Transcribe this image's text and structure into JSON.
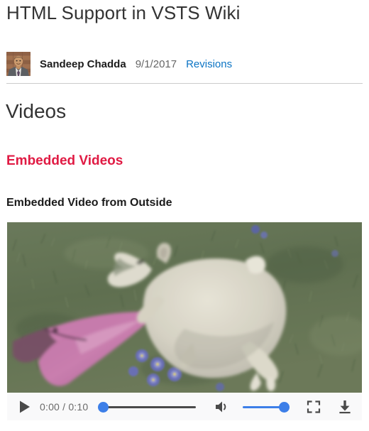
{
  "page": {
    "title": "HTML Support in VSTS Wiki"
  },
  "byline": {
    "avatar_icon": "user-photo-avatar",
    "author": "Sandeep Chadda",
    "date": "9/1/2017",
    "revisions_label": "Revisions",
    "link_color": "#0b74c4",
    "date_color": "#666666"
  },
  "sections": {
    "videos_heading": "Videos",
    "embedded_videos_heading": "Embedded Videos",
    "embedded_videos_color": "#e01a43",
    "embedded_from_outside_heading": "Embedded Video from Outside"
  },
  "video": {
    "scene_description": "white rabbit on grass with pink butterfly and purple flowers",
    "controls": {
      "play_icon": "play-icon",
      "current_time": "0:00",
      "separator": "/",
      "duration": "0:10",
      "time_display": "0:00 / 0:10",
      "seek_position_percent": 0,
      "volume_icon": "volume-on-icon",
      "volume_percent": 100,
      "fullscreen_icon": "fullscreen-icon",
      "download_icon": "download-icon",
      "accent_color": "#3d7fe8",
      "bar_background": "#f9f9fa"
    }
  }
}
